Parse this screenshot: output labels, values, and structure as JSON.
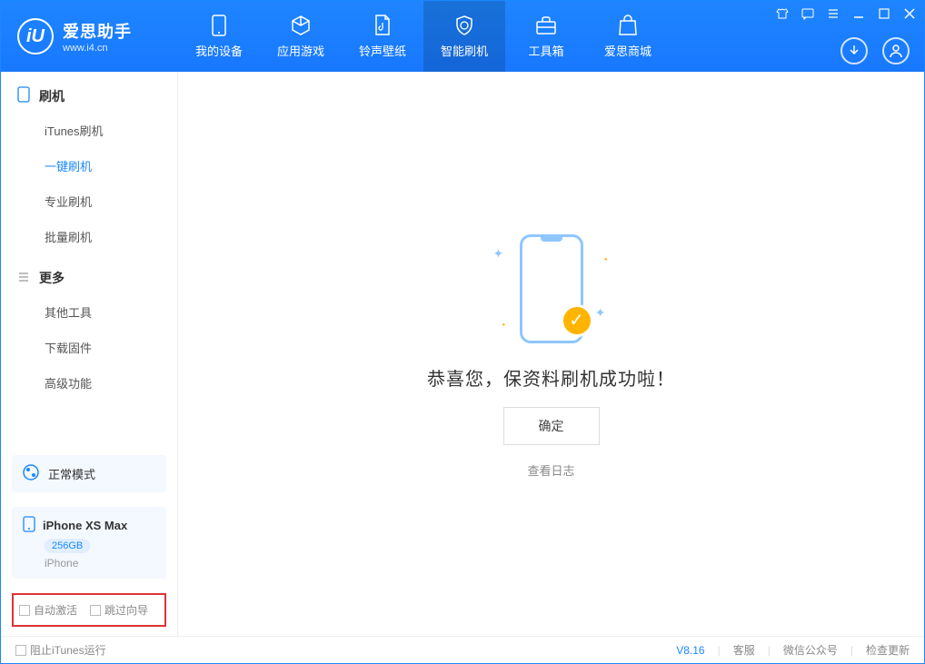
{
  "app": {
    "title": "爱思助手",
    "subtitle": "www.i4.cn"
  },
  "nav": [
    {
      "label": "我的设备"
    },
    {
      "label": "应用游戏"
    },
    {
      "label": "铃声壁纸"
    },
    {
      "label": "智能刷机"
    },
    {
      "label": "工具箱"
    },
    {
      "label": "爱思商城"
    }
  ],
  "sidebar": {
    "section1": {
      "title": "刷机",
      "items": [
        "iTunes刷机",
        "一键刷机",
        "专业刷机",
        "批量刷机"
      ]
    },
    "section2": {
      "title": "更多",
      "items": [
        "其他工具",
        "下载固件",
        "高级功能"
      ]
    }
  },
  "mode": {
    "label": "正常模式"
  },
  "device": {
    "name": "iPhone XS Max",
    "storage": "256GB",
    "type": "iPhone"
  },
  "checkboxes": {
    "auto_activate": "自动激活",
    "skip_guide": "跳过向导"
  },
  "main": {
    "success_text": "恭喜您，保资料刷机成功啦！",
    "confirm": "确定",
    "view_log": "查看日志"
  },
  "footer": {
    "block_itunes": "阻止iTunes运行",
    "version": "V8.16",
    "service": "客服",
    "wechat": "微信公众号",
    "update": "检查更新"
  }
}
